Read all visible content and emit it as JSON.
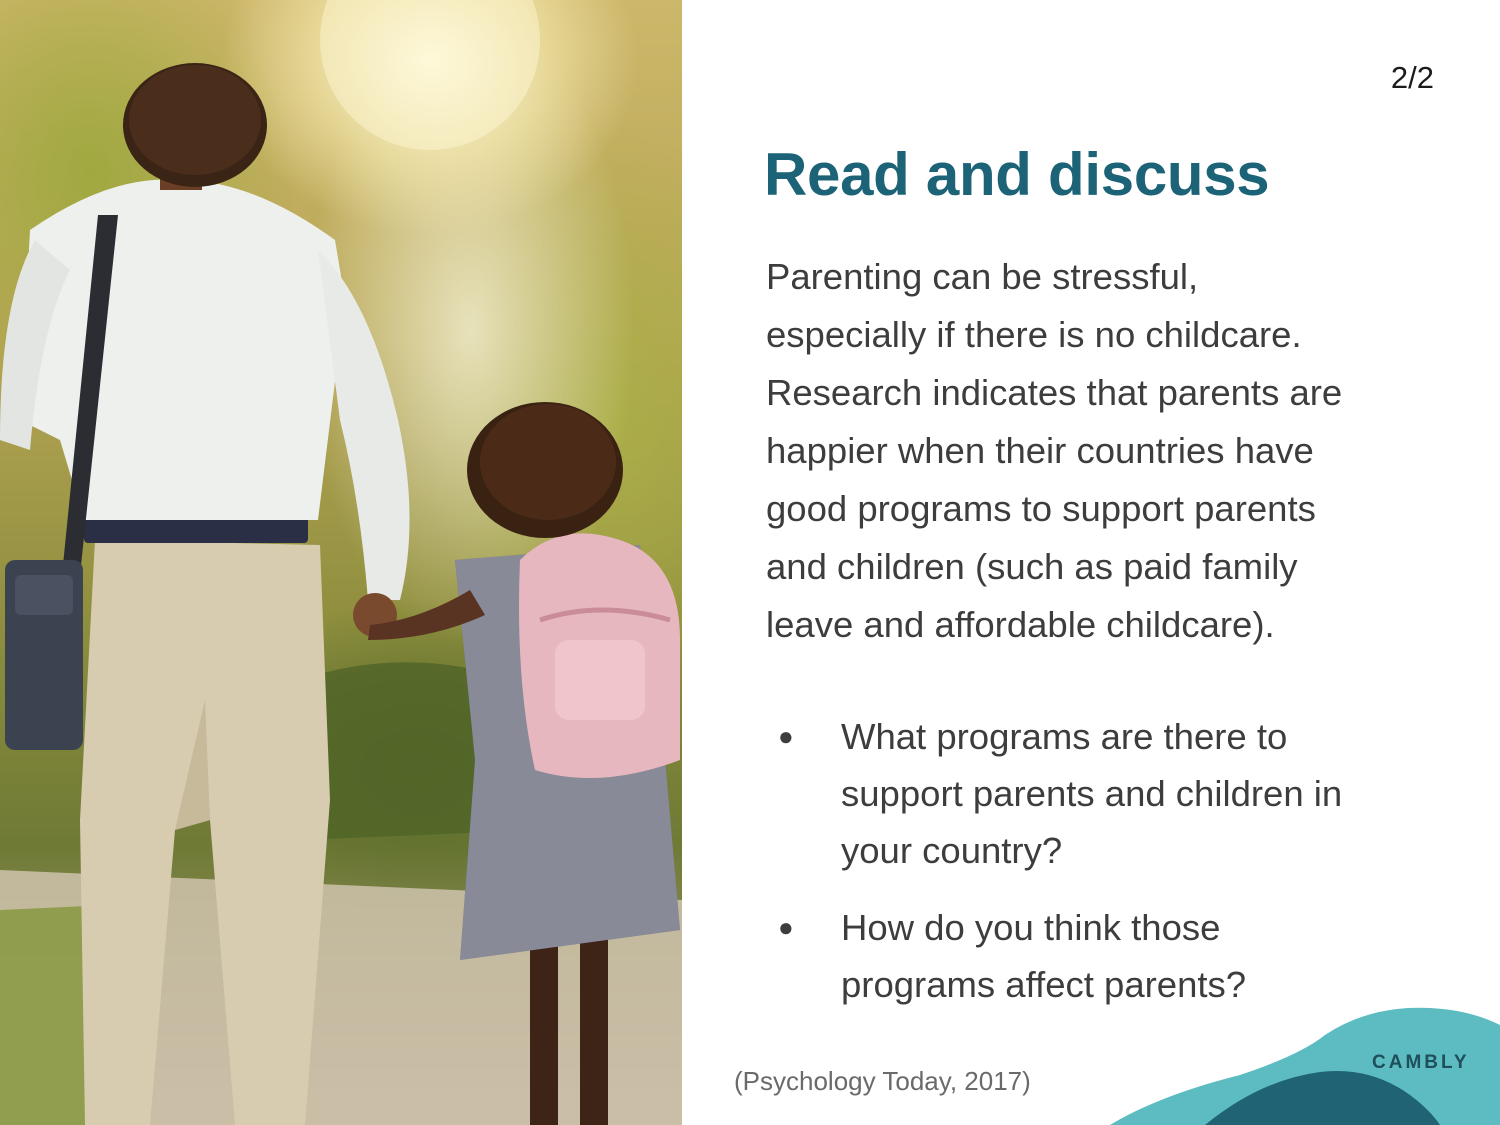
{
  "slide": {
    "page_number": "2/2",
    "title": "Read and discuss",
    "paragraph_lines": [
      "Parenting can be stressful,",
      "especially if there is no childcare.",
      "Research indicates that parents are",
      "happier when their countries have",
      "good programs to support parents",
      "and children (such as paid family",
      "leave and affordable childcare)."
    ],
    "questions": [
      {
        "bullet": "●",
        "lines": [
          "What programs are there to",
          "support parents and children in",
          "your country?"
        ]
      },
      {
        "bullet": "●",
        "lines": [
          "How do you think those",
          "programs affect parents?"
        ]
      }
    ],
    "source": "(Psychology Today, 2017)",
    "brand": "CAMBLY",
    "colors": {
      "title": "#1c6378",
      "body_text": "#3d3d3d",
      "wave_light": "#5cbcc1",
      "wave_dark": "#1f6375"
    }
  }
}
